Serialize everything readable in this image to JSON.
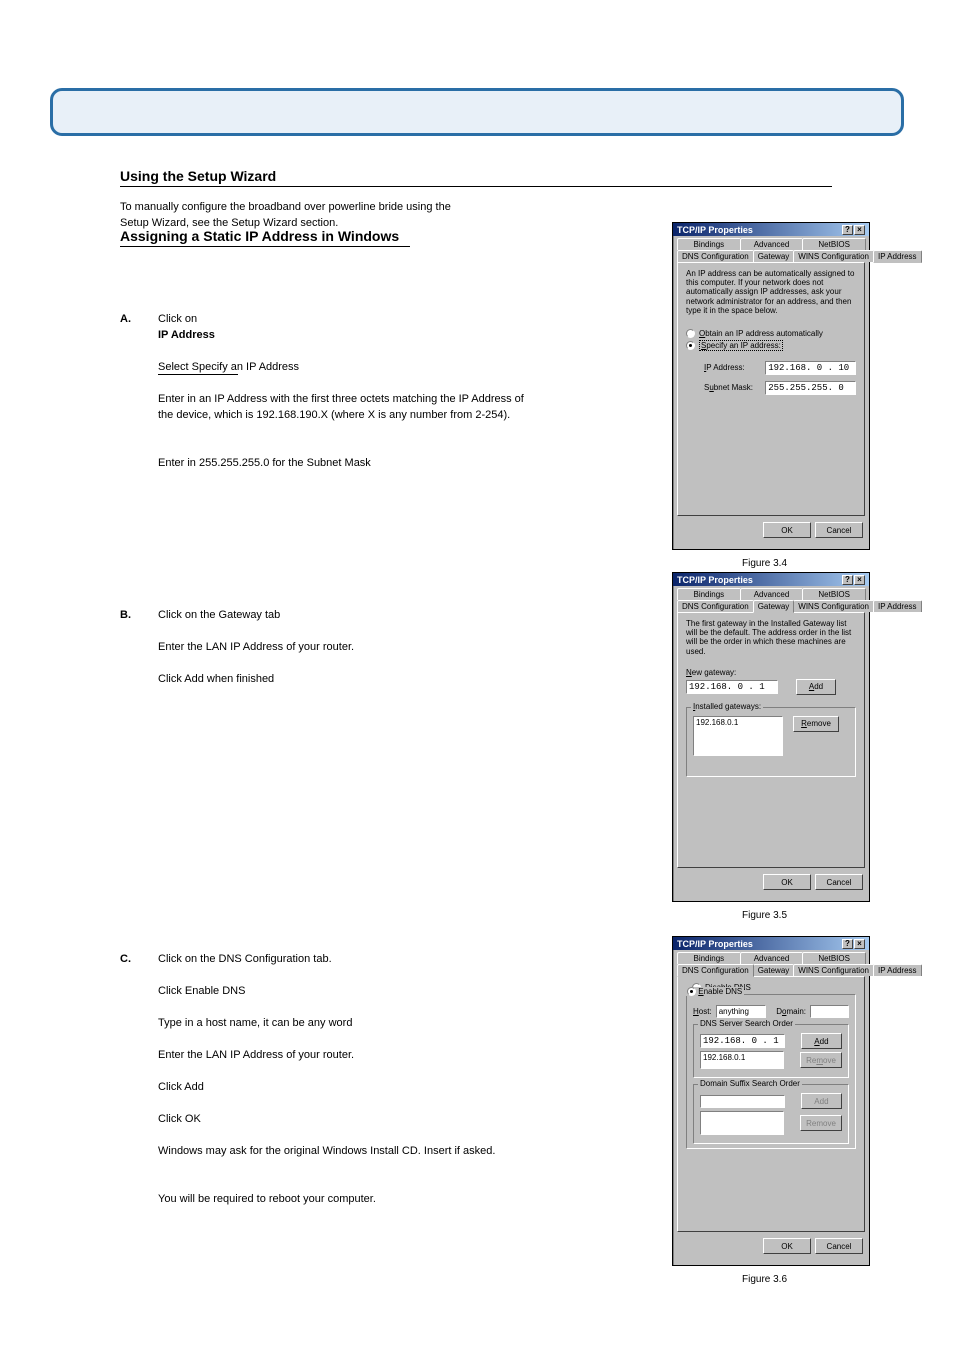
{
  "banner": {},
  "section1": {
    "title": "Using the Setup Wizard"
  },
  "section2": {
    "title": "Assigning a Static IP Address in Windows"
  },
  "intro1": "To manually configure the broadband over powerline bride using the",
  "intro2": "Setup Wizard, see the Setup Wizard section.",
  "steps": {
    "a_label": "A.",
    "a_text1": "Click on",
    "a_ip_label": "IP Address",
    "a_text2": "Select Specify an IP Address",
    "a_text3": "Enter in an IP Address with the first three octets matching the IP Address of the device, which is 192.168.190.X (where X is any number from 2-254).",
    "a_text4": "Enter in 255.255.255.0 for the Subnet Mask",
    "figa": "Figure 3.4",
    "b_label": "B.",
    "b_text1": "Click on the Gateway tab",
    "b_text2": "Enter the LAN IP Address of your router.",
    "b_text3": "Click Add when finished",
    "figb": "Figure 3.5",
    "c_label": "C.",
    "c_text1": "Click on the DNS Configuration tab.",
    "c_text2": "Click Enable DNS",
    "c_text3": "Type in a host name, it can be any word",
    "c_text4": "Enter the LAN IP Address of your router.",
    "c_text5": "Click Add",
    "c_text6": "Click OK",
    "c_text7": "Windows may ask for the original Windows Install CD. Insert if asked.",
    "c_text8": "You will be required to reboot your computer.",
    "figc": "Figure 3.6"
  },
  "dialog": {
    "title": "TCP/IP Properties",
    "help": "?",
    "close": "×",
    "tabs_top": [
      "Bindings",
      "Advanced",
      "NetBIOS"
    ],
    "tabs_bot": [
      "DNS Configuration",
      "Gateway",
      "WINS Configuration",
      "IP Address"
    ],
    "ok": "OK",
    "cancel": "Cancel"
  },
  "ip_tab": {
    "info": "An IP address can be automatically assigned to this computer. If your network does not automatically assign IP addresses, ask your network administrator for an address, and then type it in the space below.",
    "radio_auto": "Obtain an IP address automatically",
    "radio_spec": "Specify an IP address:",
    "ip_label": "IP Address:",
    "ip_value": "192.168. 0 . 10",
    "mask_label": "Subnet Mask:",
    "mask_value": "255.255.255. 0"
  },
  "gw_tab": {
    "info": "The first gateway in the Installed Gateway list will be the default. The address order in the list will be the order in which these machines are used.",
    "new_label": "New gateway:",
    "new_value": "192.168. 0 . 1",
    "add": "Add",
    "installed_legend": "Installed gateways:",
    "installed_item": "192.168.0.1",
    "remove": "Remove"
  },
  "dns_tab": {
    "radio_disable": "Disable DNS",
    "radio_enable": "Enable DNS",
    "host_label": "Host:",
    "host_value": "anything",
    "domain_label": "Domain:",
    "search_legend": "DNS Server Search Order",
    "search_value": "192.168. 0 . 1",
    "search_item": "192.168.0.1",
    "add": "Add",
    "remove": "Remove",
    "suffix_legend": "Domain Suffix Search Order",
    "suffix_add": "Add",
    "suffix_remove": "Remove"
  }
}
